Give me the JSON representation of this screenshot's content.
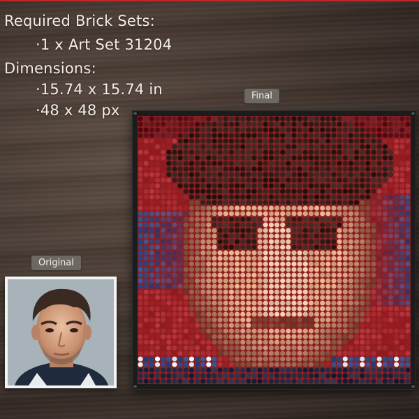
{
  "specs": {
    "required_heading": "Required Brick Sets:",
    "required_item": "·1 x Art Set 31204",
    "dimensions_heading": "Dimensions:",
    "dimension_inches": "·15.74 x 15.74 in",
    "dimension_pixels": "·48 x 48 px"
  },
  "labels": {
    "final": "Final",
    "original": "Original"
  },
  "colors": {
    "accent_top_line": "#c2262a",
    "tag_background": "#6e6863",
    "frame": "#1c1c1c",
    "mosaic_red": "#a8262b",
    "mosaic_blue": "#2c4a86",
    "mosaic_skin": "#e0a985"
  }
}
